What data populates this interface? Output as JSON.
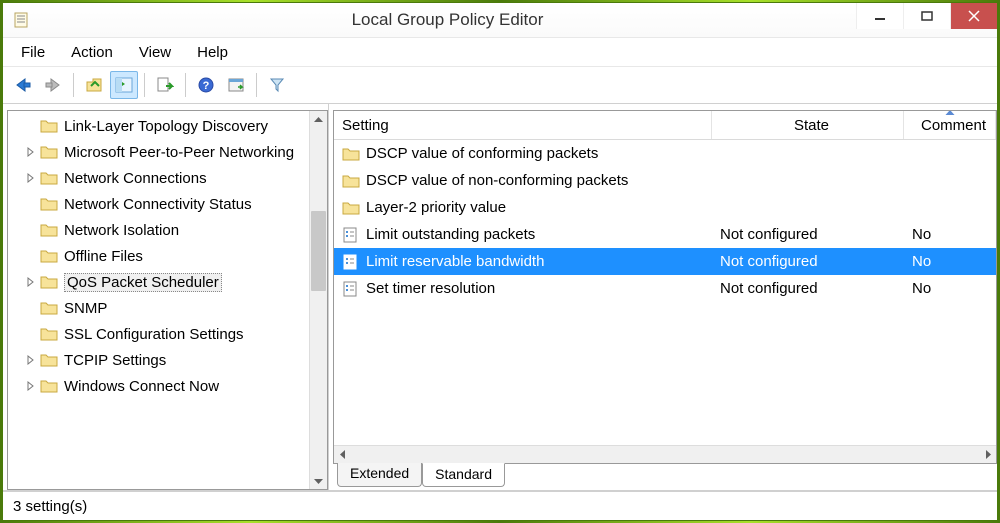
{
  "window": {
    "title": "Local Group Policy Editor"
  },
  "menu": {
    "items": [
      "File",
      "Action",
      "View",
      "Help"
    ]
  },
  "tree": {
    "items": [
      {
        "label": "Link-Layer Topology Discovery",
        "expander": false
      },
      {
        "label": "Microsoft Peer-to-Peer Networking",
        "expander": true
      },
      {
        "label": "Network Connections",
        "expander": true
      },
      {
        "label": "Network Connectivity Status",
        "expander": false
      },
      {
        "label": "Network Isolation",
        "expander": false
      },
      {
        "label": "Offline Files",
        "expander": false
      },
      {
        "label": "QoS Packet Scheduler",
        "expander": true,
        "selected": true
      },
      {
        "label": "SNMP",
        "expander": false
      },
      {
        "label": "SSL Configuration Settings",
        "expander": false
      },
      {
        "label": "TCPIP Settings",
        "expander": true
      },
      {
        "label": "Windows Connect Now",
        "expander": true
      }
    ]
  },
  "list": {
    "columns": {
      "setting": "Setting",
      "state": "State",
      "comment": "Comment"
    },
    "rows": [
      {
        "type": "folder",
        "setting": "DSCP value of conforming packets",
        "state": "",
        "comment": ""
      },
      {
        "type": "folder",
        "setting": "DSCP value of non-conforming packets",
        "state": "",
        "comment": ""
      },
      {
        "type": "folder",
        "setting": "Layer-2 priority value",
        "state": "",
        "comment": ""
      },
      {
        "type": "policy",
        "setting": "Limit outstanding packets",
        "state": "Not configured",
        "comment": "No"
      },
      {
        "type": "policy",
        "setting": "Limit reservable bandwidth",
        "state": "Not configured",
        "comment": "No",
        "selected": true
      },
      {
        "type": "policy",
        "setting": "Set timer resolution",
        "state": "Not configured",
        "comment": "No"
      }
    ]
  },
  "tabs": {
    "extended": "Extended",
    "standard": "Standard"
  },
  "status": "3 setting(s)"
}
